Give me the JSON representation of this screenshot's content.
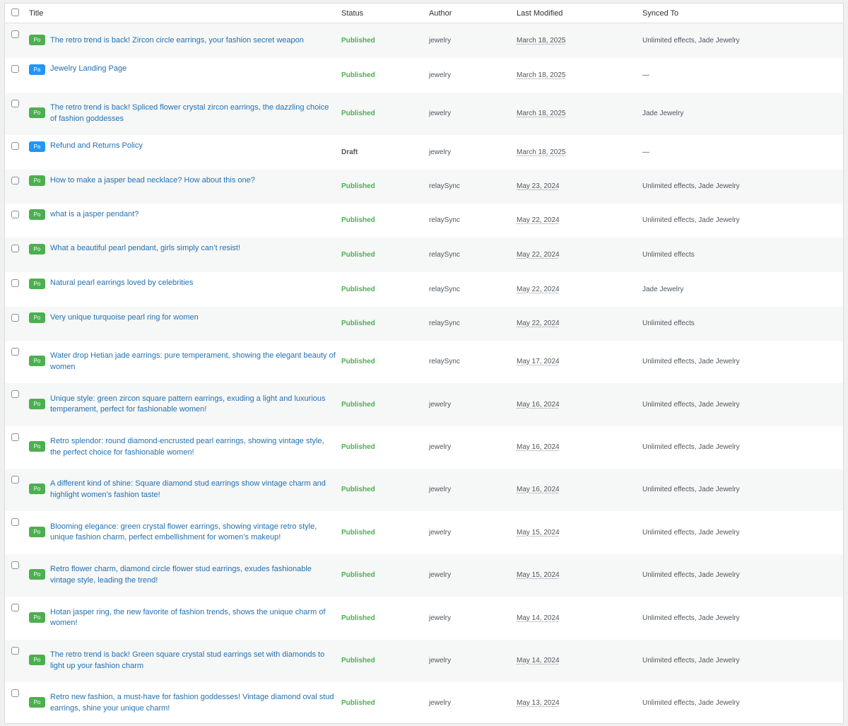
{
  "table": {
    "columns": {
      "title": "Title",
      "status": "Status",
      "author": "Author",
      "last_modified": "Last Modified",
      "synced_to": "Synced To"
    },
    "rows": [
      {
        "badge": "Po",
        "title": "The retro trend is back! Zircon circle earrings, your fashion secret weapon",
        "status": "Published",
        "author": "jewelry",
        "modified": "March 18, 2025",
        "synced": "Unlimited effects, Jade Jewelry"
      },
      {
        "badge": "Pa",
        "title": "Jewelry Landing Page",
        "status": "Published",
        "author": "jewelry",
        "modified": "March 18, 2025",
        "synced": "—"
      },
      {
        "badge": "Po",
        "title": "The retro trend is back! Spliced flower crystal zircon earrings, the dazzling choice of fashion goddesses",
        "status": "Published",
        "author": "jewelry",
        "modified": "March 18, 2025",
        "synced": "Jade Jewelry"
      },
      {
        "badge": "Pa",
        "title": "Refund and Returns Policy",
        "status": "Draft",
        "author": "jewelry",
        "modified": "March 18, 2025",
        "synced": "—"
      },
      {
        "badge": "Po",
        "title": "How to make a jasper bead necklace? How about this one?",
        "status": "Published",
        "author": "relaySync",
        "modified": "May 23, 2024",
        "synced": "Unlimited effects, Jade Jewelry"
      },
      {
        "badge": "Po",
        "title": "what is a jasper pendant?",
        "status": "Published",
        "author": "relaySync",
        "modified": "May 22, 2024",
        "synced": "Unlimited effects, Jade Jewelry"
      },
      {
        "badge": "Po",
        "title": "What a beautiful pearl pendant, girls simply can’t resist!",
        "status": "Published",
        "author": "relaySync",
        "modified": "May 22, 2024",
        "synced": "Unlimited effects"
      },
      {
        "badge": "Po",
        "title": "Natural pearl earrings loved by celebrities",
        "status": "Published",
        "author": "relaySync",
        "modified": "May 22, 2024",
        "synced": "Jade Jewelry"
      },
      {
        "badge": "Po",
        "title": "Very unique turquoise pearl ring for women",
        "status": "Published",
        "author": "relaySync",
        "modified": "May 22, 2024",
        "synced": "Unlimited effects"
      },
      {
        "badge": "Po",
        "title": "Water drop Hetian jade earrings: pure temperament, showing the elegant beauty of women",
        "status": "Published",
        "author": "relaySync",
        "modified": "May 17, 2024",
        "synced": "Unlimited effects, Jade Jewelry"
      },
      {
        "badge": "Po",
        "title": "Unique style: green zircon square pattern earrings, exuding a light and luxurious temperament, perfect for fashionable women!",
        "status": "Published",
        "author": "jewelry",
        "modified": "May 16, 2024",
        "synced": "Unlimited effects, Jade Jewelry"
      },
      {
        "badge": "Po",
        "title": "Retro splendor: round diamond-encrusted pearl earrings, showing vintage style, the perfect choice for fashionable women!",
        "status": "Published",
        "author": "jewelry",
        "modified": "May 16, 2024",
        "synced": "Unlimited effects, Jade Jewelry"
      },
      {
        "badge": "Po",
        "title": "A different kind of shine: Square diamond stud earrings show vintage charm and highlight women’s fashion taste!",
        "status": "Published",
        "author": "jewelry",
        "modified": "May 16, 2024",
        "synced": "Unlimited effects, Jade Jewelry"
      },
      {
        "badge": "Po",
        "title": "Blooming elegance: green crystal flower earrings, showing vintage retro style, unique fashion charm, perfect embellishment for women’s makeup!",
        "status": "Published",
        "author": "jewelry",
        "modified": "May 15, 2024",
        "synced": "Unlimited effects, Jade Jewelry"
      },
      {
        "badge": "Po",
        "title": "Retro flower charm, diamond circle flower stud earrings, exudes fashionable vintage style, leading the trend!",
        "status": "Published",
        "author": "jewelry",
        "modified": "May 15, 2024",
        "synced": "Unlimited effects, Jade Jewelry"
      },
      {
        "badge": "Po",
        "title": "Hotan jasper ring, the new favorite of fashion trends, shows the unique charm of women!",
        "status": "Published",
        "author": "jewelry",
        "modified": "May 14, 2024",
        "synced": "Unlimited effects, Jade Jewelry"
      },
      {
        "badge": "Po",
        "title": "The retro trend is back! Green square crystal stud earrings set with diamonds to light up your fashion charm",
        "status": "Published",
        "author": "jewelry",
        "modified": "May 14, 2024",
        "synced": "Unlimited effects, Jade Jewelry"
      },
      {
        "badge": "Po",
        "title": "Retro new fashion, a must-have for fashion goddesses! Vintage diamond oval stud earrings, shine your unique charm!",
        "status": "Published",
        "author": "jewelry",
        "modified": "May 13, 2024",
        "synced": "Unlimited effects, Jade Jewelry"
      }
    ]
  },
  "colors": {
    "link": "#2271b1",
    "published": "#4caf50",
    "badge_post": "#4caf50",
    "badge_page": "#2196f3",
    "row_alt": "#f6f7f7"
  }
}
